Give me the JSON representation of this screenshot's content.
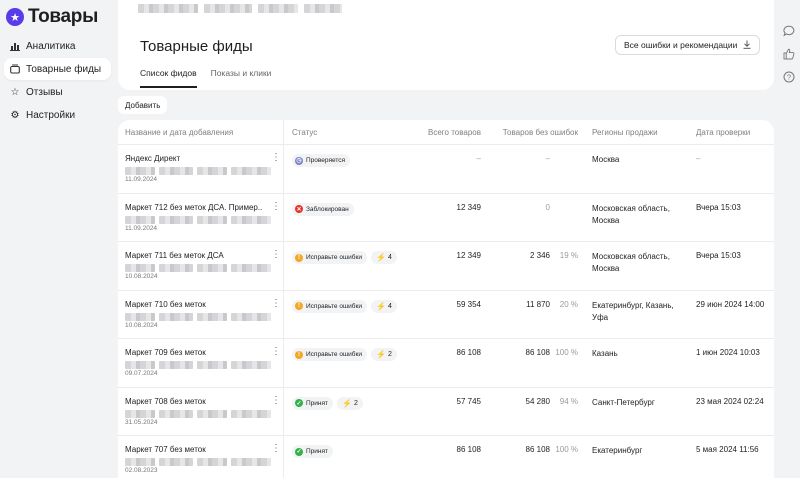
{
  "app": {
    "title": "Товары"
  },
  "sidebar": {
    "items": [
      {
        "label": "Аналитика",
        "icon": "bar-chart-icon",
        "active": false
      },
      {
        "label": "Товарные фиды",
        "icon": "feed-icon",
        "active": true
      },
      {
        "label": "Отзывы",
        "icon": "star-icon",
        "active": false
      },
      {
        "label": "Настройки",
        "icon": "gear-icon",
        "active": false
      }
    ]
  },
  "header": {
    "title": "Товарные фиды",
    "errors_button": "Все ошибки и рекомендации",
    "tabs": [
      {
        "label": "Список фидов",
        "active": true
      },
      {
        "label": "Показы и клики",
        "active": false
      }
    ]
  },
  "toolbar": {
    "add_label": "Добавить"
  },
  "table": {
    "columns": [
      "Название и дата добавления",
      "Статус",
      "Всего товаров",
      "Товаров без ошибок",
      "Регионы продажи",
      "Дата проверки"
    ],
    "rows": [
      {
        "name": "Яндекс Директ",
        "date": "11.09.2024",
        "status": "Проверяется",
        "status_type": "checking",
        "warnings": "",
        "total": "–",
        "ok": "–",
        "pct": "",
        "region": "Москва",
        "checked": "–"
      },
      {
        "name": "Маркет 712 без меток ДСА. Пример...",
        "date": "11.09.2024",
        "status": "Заблокирован",
        "status_type": "blocked",
        "warnings": "",
        "total": "12 349",
        "ok": "0",
        "pct": "",
        "region": "Московская область, Москва",
        "checked": "Вчера 15:03"
      },
      {
        "name": "Маркет 711 без меток ДСА",
        "date": "10.08.2024",
        "status": "Исправьте ошибки",
        "status_type": "errors",
        "warnings": "4",
        "total": "12 349",
        "ok": "2 346",
        "pct": "19 %",
        "region": "Московская область, Москва",
        "checked": "Вчера 15:03"
      },
      {
        "name": "Маркет 710 без меток",
        "date": "10.08.2024",
        "status": "Исправьте ошибки",
        "status_type": "errors",
        "warnings": "4",
        "total": "59 354",
        "ok": "11 870",
        "pct": "20 %",
        "region": "Екатеринбург, Казань, Уфа",
        "checked": "29 июн 2024 14:00"
      },
      {
        "name": "Маркет 709 без меток",
        "date": "09.07.2024",
        "status": "Исправьте ошибки",
        "status_type": "errors",
        "warnings": "2",
        "total": "86 108",
        "ok": "86 108",
        "pct": "100 %",
        "region": "Казань",
        "checked": "1 июн 2024 10:03"
      },
      {
        "name": "Маркет 708 без меток",
        "date": "31.05.2024",
        "status": "Принят",
        "status_type": "accepted",
        "warnings": "2",
        "total": "57 745",
        "ok": "54 280",
        "pct": "94 %",
        "region": "Санкт-Петербург",
        "checked": "23 мая 2024 02:24"
      },
      {
        "name": "Маркет 707 без меток",
        "date": "02.08.2023",
        "status": "Принят",
        "status_type": "accepted",
        "warnings": "",
        "total": "86 108",
        "ok": "86 108",
        "pct": "100 %",
        "region": "Екатеринбург",
        "checked": "5 мая 2024 11:56"
      }
    ]
  },
  "status_colors": {
    "checking": "#7b83c6",
    "blocked": "#e5322d",
    "errors": "#f5a623",
    "accepted": "#33b24a"
  },
  "rail": [
    {
      "icon": "chat-icon"
    },
    {
      "icon": "thumbs-up-icon"
    },
    {
      "icon": "help-icon"
    }
  ]
}
